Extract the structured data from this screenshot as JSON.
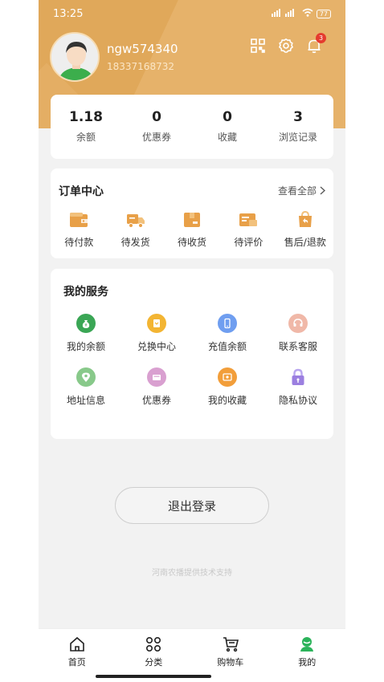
{
  "status_bar": {
    "time": "13:25",
    "signal": "5G",
    "battery": "77"
  },
  "profile": {
    "username": "ngw574340",
    "phone": "18337168732",
    "notification_count": "3"
  },
  "stats": [
    {
      "value": "1.18",
      "label": "余额"
    },
    {
      "value": "0",
      "label": "优惠券"
    },
    {
      "value": "0",
      "label": "收藏"
    },
    {
      "value": "3",
      "label": "浏览记录"
    }
  ],
  "orders": {
    "title": "订单中心",
    "view_all": "查看全部",
    "items": [
      {
        "label": "待付款",
        "icon": "wallet-icon"
      },
      {
        "label": "待发货",
        "icon": "delivery-truck-icon"
      },
      {
        "label": "待收货",
        "icon": "package-box-icon"
      },
      {
        "label": "待评价",
        "icon": "review-card-icon"
      },
      {
        "label": "售后/退款",
        "icon": "refund-bag-icon"
      }
    ]
  },
  "services": {
    "title": "我的服务",
    "items": [
      {
        "label": "我的余额",
        "icon": "money-bag-icon",
        "color": "#3aa655"
      },
      {
        "label": "兑换中心",
        "icon": "exchange-icon",
        "color": "#f3b533"
      },
      {
        "label": "充值余额",
        "icon": "phone-recharge-icon",
        "color": "#6f9ef0"
      },
      {
        "label": "联系客服",
        "icon": "customer-service-icon",
        "color": "#f0b8a8"
      },
      {
        "label": "地址信息",
        "icon": "location-pin-icon",
        "color": "#88c98a"
      },
      {
        "label": "优惠券",
        "icon": "coupon-icon",
        "color": "#d9a0d0"
      },
      {
        "label": "我的收藏",
        "icon": "favorites-icon",
        "color": "#f29e3a"
      },
      {
        "label": "隐私协议",
        "icon": "lock-icon",
        "color": "#9b7fe0"
      }
    ]
  },
  "logout_label": "退出登录",
  "footer_note": "河南农播提供技术支持",
  "tabs": [
    {
      "label": "首页",
      "icon": "home-icon"
    },
    {
      "label": "分类",
      "icon": "category-grid-icon"
    },
    {
      "label": "购物车",
      "icon": "cart-icon"
    },
    {
      "label": "我的",
      "icon": "profile-icon",
      "active": true
    }
  ],
  "colors": {
    "header": "#e0a85a",
    "accent_orange": "#e8a048",
    "active_green": "#2bb35a"
  }
}
